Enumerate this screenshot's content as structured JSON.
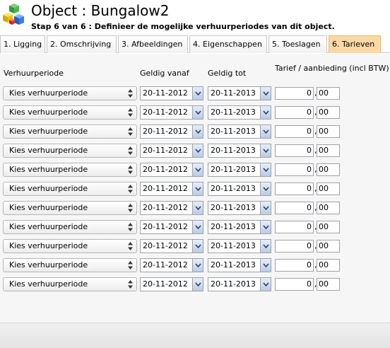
{
  "header": {
    "title": "Object : Bungalow2",
    "subtitle": "Stap 6 van 6 : Definieer de mogelijke verhuurperiodes van dit object.",
    "icon": "colored-cubes-icon"
  },
  "tabs": [
    {
      "label": "1. Ligging",
      "active": false
    },
    {
      "label": "2. Omschrijving",
      "active": false
    },
    {
      "label": "3. Afbeeldingen",
      "active": false
    },
    {
      "label": "4. Eigenschappen",
      "active": false
    },
    {
      "label": "5. Toeslagen",
      "active": false
    },
    {
      "label": "6. Tarieven",
      "active": true
    }
  ],
  "columns": {
    "period": "Verhuurperiode",
    "from": "Geldig vanaf",
    "to": "Geldig tot",
    "price": "Tarief / aanbieding (incl BTW)"
  },
  "rows": [
    {
      "period": "Kies verhuurperiode",
      "from": "20-11-2012",
      "to": "20-11-2013",
      "euros": "0",
      "cents": "00"
    },
    {
      "period": "Kies verhuurperiode",
      "from": "20-11-2012",
      "to": "20-11-2013",
      "euros": "0",
      "cents": "00"
    },
    {
      "period": "Kies verhuurperiode",
      "from": "20-11-2012",
      "to": "20-11-2013",
      "euros": "0",
      "cents": "00"
    },
    {
      "period": "Kies verhuurperiode",
      "from": "20-11-2012",
      "to": "20-11-2013",
      "euros": "0",
      "cents": "00"
    },
    {
      "period": "Kies verhuurperiode",
      "from": "20-11-2012",
      "to": "20-11-2013",
      "euros": "0",
      "cents": "00"
    },
    {
      "period": "Kies verhuurperiode",
      "from": "20-11-2012",
      "to": "20-11-2013",
      "euros": "0",
      "cents": "00"
    },
    {
      "period": "Kies verhuurperiode",
      "from": "20-11-2012",
      "to": "20-11-2013",
      "euros": "0",
      "cents": "00"
    },
    {
      "period": "Kies verhuurperiode",
      "from": "20-11-2012",
      "to": "20-11-2013",
      "euros": "0",
      "cents": "00"
    },
    {
      "period": "Kies verhuurperiode",
      "from": "20-11-2012",
      "to": "20-11-2013",
      "euros": "0",
      "cents": "00"
    },
    {
      "period": "Kies verhuurperiode",
      "from": "20-11-2012",
      "to": "20-11-2013",
      "euros": "0",
      "cents": "00"
    },
    {
      "period": "Kies verhuurperiode",
      "from": "20-11-2012",
      "to": "20-11-2013",
      "euros": "0",
      "cents": "00"
    }
  ],
  "decimal_separator": ",",
  "colors": {
    "active_tab": "#fbd9a4",
    "panel_bg": "#f6f6f6"
  }
}
